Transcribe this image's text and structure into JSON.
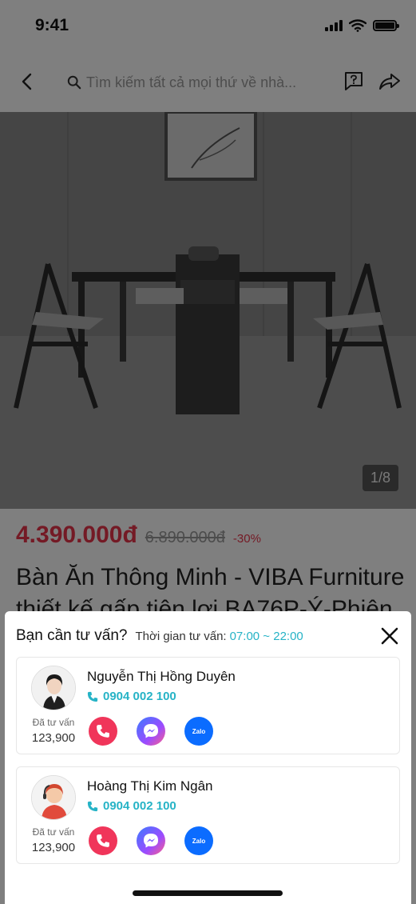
{
  "status_bar": {
    "time": "9:41"
  },
  "nav": {
    "search_placeholder": "Tìm kiếm tất cả mọi thứ về nhà..."
  },
  "product": {
    "image_counter": "1/8",
    "price": "4.390.000đ",
    "old_price": "6.890.000đ",
    "discount": "-30%",
    "title": "Bàn Ăn Thông Minh - VIBA Furniture thiết kế gấp tiện lợi BA76P-Ý-Phiên"
  },
  "sheet": {
    "title": "Bạn cần tư vấn?",
    "time_label": "Thời gian tư vấn:",
    "time_value": "07:00 ~ 22:00",
    "agents": [
      {
        "name": "Nguyễn Thị Hồng Duyên",
        "phone": "0904 002 100",
        "consult_label": "Đã tư vấn",
        "consult_count": "123,900",
        "zalo_label": "Zalo"
      },
      {
        "name": "Hoàng Thị Kim Ngân",
        "phone": "0904 002 100",
        "consult_label": "Đã tư vấn",
        "consult_count": "123,900",
        "zalo_label": "Zalo"
      }
    ]
  },
  "colors": {
    "accent_red": "#e8344a",
    "accent_teal": "#26b3c6",
    "call_red": "#f0355a",
    "zalo_blue": "#0b6cff"
  },
  "icons": [
    "back-icon",
    "search-icon",
    "chat-question-icon",
    "share-icon",
    "close-icon",
    "phone-icon",
    "call-icon",
    "messenger-icon",
    "zalo-icon"
  ]
}
